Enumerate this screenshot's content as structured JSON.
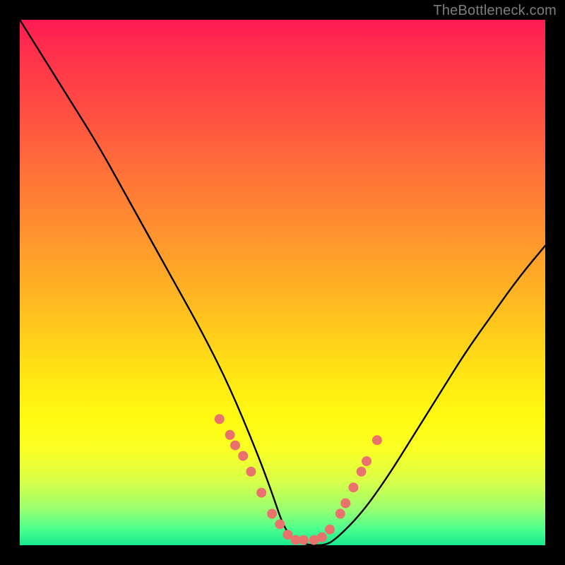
{
  "watermark": "TheBottleneck.com",
  "chart_data": {
    "type": "line",
    "title": "",
    "xlabel": "",
    "ylabel": "",
    "xlim": [
      0,
      100
    ],
    "ylim": [
      0,
      100
    ],
    "background_gradient": {
      "orientation": "vertical",
      "stops": [
        {
          "pos": 0,
          "color": "#ff1a52"
        },
        {
          "pos": 18,
          "color": "#ff5042"
        },
        {
          "pos": 46,
          "color": "#ffa229"
        },
        {
          "pos": 68,
          "color": "#ffe714"
        },
        {
          "pos": 88,
          "color": "#d7ff4a"
        },
        {
          "pos": 100,
          "color": "#18e88e"
        }
      ]
    },
    "series": [
      {
        "name": "bottleneck-curve",
        "color": "#000000",
        "x": [
          0,
          5,
          10,
          15,
          20,
          25,
          30,
          35,
          40,
          45,
          48,
          50,
          52,
          55,
          58,
          60,
          65,
          70,
          75,
          80,
          85,
          90,
          95,
          100
        ],
        "y": [
          100,
          92,
          84,
          76,
          67,
          58,
          49,
          40,
          30,
          18,
          10,
          4,
          1,
          0,
          0,
          1,
          6,
          13,
          21,
          29,
          37,
          44,
          51,
          57
        ]
      },
      {
        "name": "dot-markers",
        "color": "#e9736c",
        "type": "scatter",
        "x": [
          38,
          40,
          41,
          42.5,
          44,
          46,
          48,
          49.5,
          51,
          52.5,
          54,
          56,
          57.5,
          59,
          61,
          62,
          63.5,
          65,
          66,
          68
        ],
        "y": [
          24,
          21,
          19,
          17,
          14,
          10,
          6,
          4,
          2,
          1,
          1,
          1,
          1.5,
          3,
          6,
          8,
          11,
          14,
          16,
          20
        ]
      }
    ]
  }
}
